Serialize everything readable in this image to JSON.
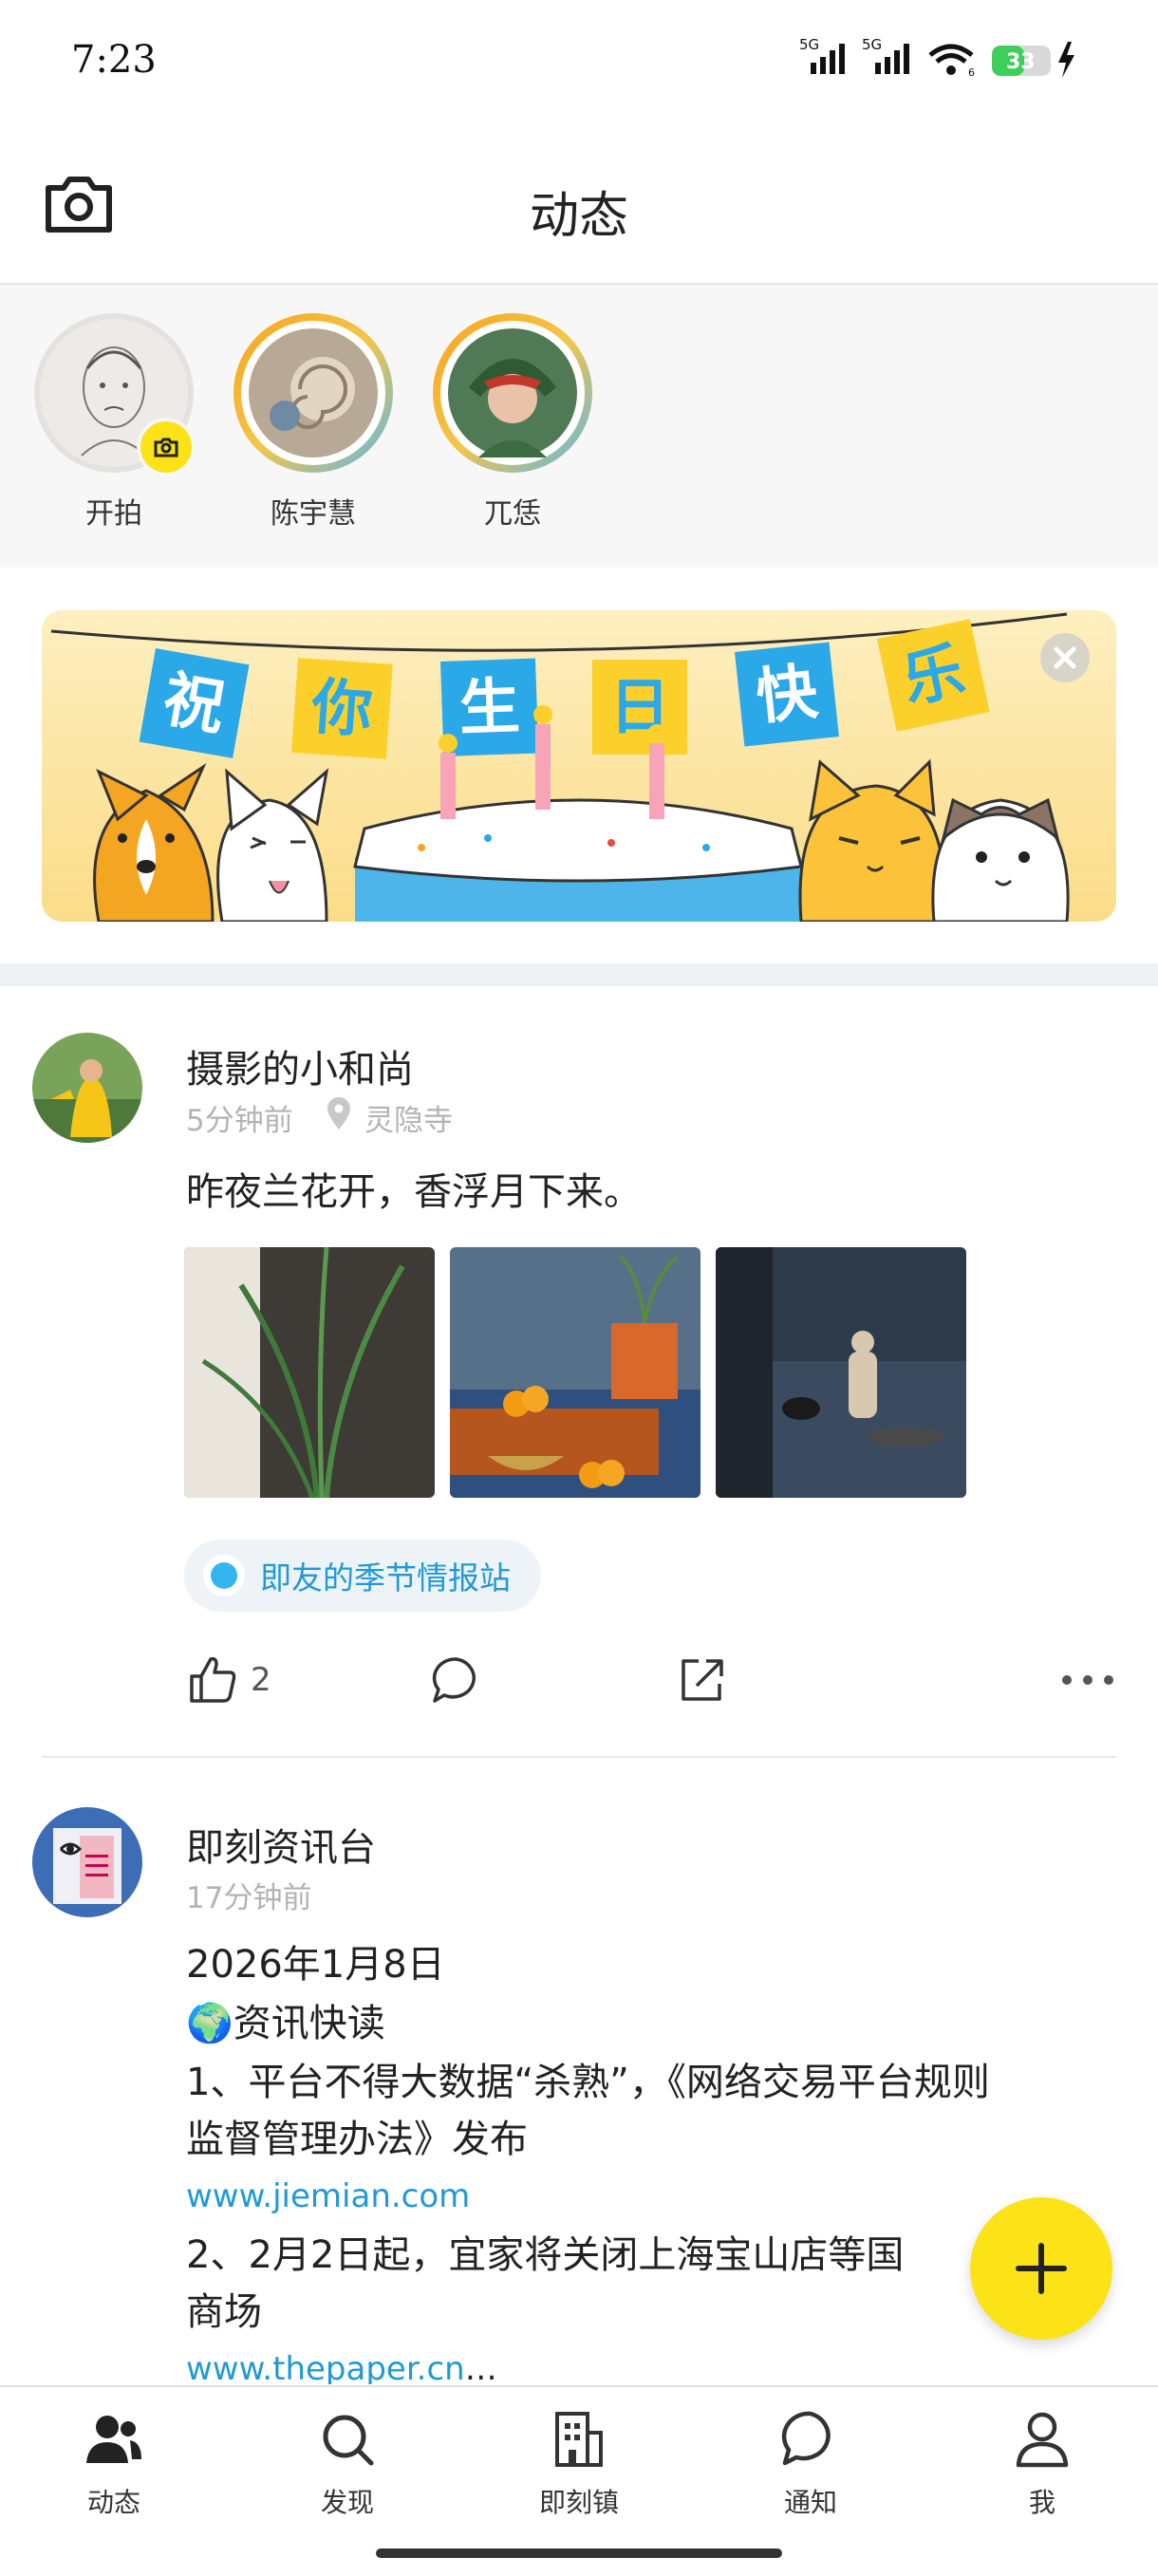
{
  "status_bar": {
    "time": "7:23",
    "battery": "33",
    "net1": "5G",
    "net2": "5G",
    "wifi_badge": "6"
  },
  "header": {
    "title": "动态"
  },
  "stories": [
    {
      "label": "开拍"
    },
    {
      "label": "陈宇慧"
    },
    {
      "label": "兀恁"
    }
  ],
  "banner": {
    "chars": [
      "祝",
      "你",
      "生",
      "日",
      "快",
      "乐"
    ]
  },
  "posts": [
    {
      "author": "摄影的小和尚",
      "time": "5分钟前",
      "location": "灵隐寺",
      "text": "昨夜兰花开，香浮月下来。",
      "topic": "即友的季节情报站",
      "likes": "2"
    },
    {
      "author": "即刻资讯台",
      "time": "17分钟前",
      "lines": [
        "2026年1月8日",
        "🌍资讯快读",
        "1、平台不得大数据“杀熟”，《网络交易平台规则",
        "监督管理办法》发布"
      ],
      "link1": "www.jiemian.com",
      "line5": "2、2月2日起，宜家将关闭上海宝山店等国",
      "line6": "商场",
      "link2": "www.thepaper.cn",
      "ellipsis": "…"
    }
  ],
  "tabs": [
    {
      "label": "动态"
    },
    {
      "label": "发现"
    },
    {
      "label": "即刻镇"
    },
    {
      "label": "通知"
    },
    {
      "label": "我"
    }
  ],
  "colors": {
    "accent_yellow": "#fbe318",
    "link_blue": "#1f9ad6",
    "battery_green": "#3ecf5a"
  }
}
